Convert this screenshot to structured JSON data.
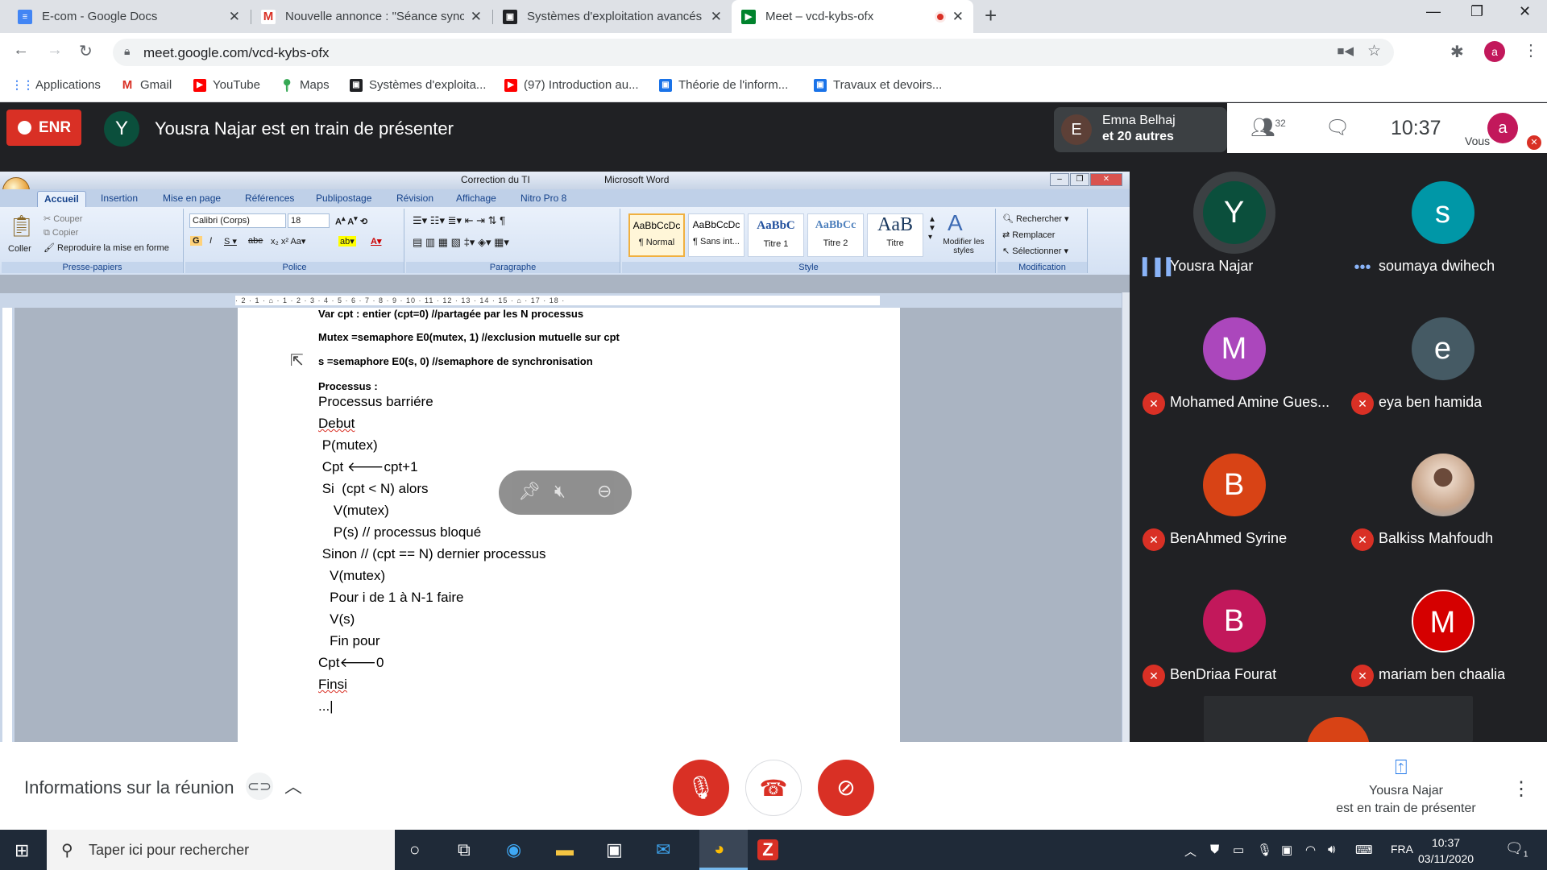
{
  "browser": {
    "tabs": [
      {
        "title": "E-com - Google Docs",
        "icon": "google-docs-icon",
        "color": "#4285f4"
      },
      {
        "title": "Nouvelle annonce : \"Séance sync",
        "icon": "gmail-icon",
        "color": "#d93025"
      },
      {
        "title": "Systèmes d'exploitation avancés",
        "icon": "classroom-icon",
        "color": "#202124"
      },
      {
        "title": "Meet – vcd-kybs-ofx",
        "icon": "meet-icon",
        "color": "#00832d"
      }
    ],
    "url": "meet.google.com/vcd-kybs-ofx",
    "profile_initial": "a",
    "bookmarks": [
      {
        "label": "Applications",
        "color": "#4285f4"
      },
      {
        "label": "Gmail",
        "color": "#d93025"
      },
      {
        "label": "YouTube",
        "color": "#ff0000"
      },
      {
        "label": "Maps",
        "color": "#34a853"
      },
      {
        "label": "Systèmes d'exploita...",
        "color": "#202124"
      },
      {
        "label": "(97) Introduction au...",
        "color": "#ff0000"
      },
      {
        "label": "Théorie de l'inform...",
        "color": "#1a73e8"
      },
      {
        "label": "Travaux et devoirs...",
        "color": "#1a73e8"
      }
    ]
  },
  "meet": {
    "rec_label": "ENR",
    "presenter_initial": "Y",
    "presenting_text": "Yousra Najar est en train de présenter",
    "people_preview": {
      "initial": "E",
      "line1": "Emna Belhaj",
      "line2": "et 20 autres"
    },
    "participant_count": "32",
    "time": "10:37",
    "vous_label": "Vous",
    "vous_initial": "a",
    "participants": [
      {
        "initial": "Y",
        "name": "Yousra Najar",
        "color": "#0b4f3c",
        "status": "speaking"
      },
      {
        "initial": "s",
        "name": "soumaya dwihech",
        "color": "#0097a7",
        "status": "dots"
      },
      {
        "initial": "M",
        "name": "Mohamed Amine Gues...",
        "color": "#ab47bc",
        "status": "muted"
      },
      {
        "initial": "e",
        "name": "eya ben hamida",
        "color": "#455a64",
        "status": "muted"
      },
      {
        "initial": "B",
        "name": "BenAhmed Syrine",
        "color": "#d84315",
        "status": "muted"
      },
      {
        "initial": "",
        "name": "Balkiss Mahfoudh",
        "color": "#c7a48a",
        "status": "muted"
      },
      {
        "initial": "B",
        "name": "BenDriaa Fourat",
        "color": "#c2185b",
        "status": "muted"
      },
      {
        "initial": "M",
        "name": "mariam ben chaalia",
        "color": "#d50000",
        "status": "muted"
      }
    ],
    "info_label": "Informations sur la réunion",
    "present_line1": "Yousra Najar",
    "present_line2": "est en train de présenter"
  },
  "word": {
    "title_doc": "Correction du TI",
    "title_app": "Microsoft Word",
    "tabs": [
      "Accueil",
      "Insertion",
      "Mise en page",
      "Références",
      "Publipostage",
      "Révision",
      "Affichage",
      "Nitro Pro 8"
    ],
    "clipboard": {
      "paste": "Coller",
      "cut": "Couper",
      "copy": "Copier",
      "format": "Reproduire la mise en forme",
      "label": "Presse-papiers"
    },
    "font": {
      "name": "Calibri (Corps)",
      "size": "18",
      "label": "Police"
    },
    "paragraph_label": "Paragraphe",
    "styles": [
      {
        "preview": "AaBbCcDc",
        "name": "¶ Normal"
      },
      {
        "preview": "AaBbCcDc",
        "name": "¶ Sans int..."
      },
      {
        "preview": "AaBbC",
        "name": "Titre 1"
      },
      {
        "preview": "AaBbCc",
        "name": "Titre 2"
      },
      {
        "preview": "AaB",
        "name": "Titre"
      }
    ],
    "modify_styles": "Modifier les styles",
    "style_label": "Style",
    "editing": {
      "find": "Rechercher",
      "replace": "Remplacer",
      "select": "Sélectionner",
      "label": "Modification"
    },
    "doc_lines": [
      "Var cpt : entier (cpt=0) //partagée par les N processus",
      "Mutex =semaphore E0(mutex, 1) //exclusion mutuelle sur cpt",
      "s =semaphore E0(s, 0) //semaphore de synchronisation",
      "Processus :",
      "Processus barriére",
      "Debut",
      " P(mutex)",
      " Cpt 🡐cpt+1",
      " Si  (cpt < N) alors",
      "    V(mutex)",
      "    P(s) // processus bloqué",
      " Sinon // (cpt == N) dernier processus",
      "   V(mutex)",
      "   Pour i de 1 à N-1 faire",
      "   V(s)",
      "   Fin pour",
      "Cpt🡐0",
      "Finsi",
      "...|"
    ]
  },
  "taskbar": {
    "search_placeholder": "Taper ici pour rechercher",
    "lang": "FRA",
    "time": "10:37",
    "date": "03/11/2020",
    "notif_count": "1"
  }
}
